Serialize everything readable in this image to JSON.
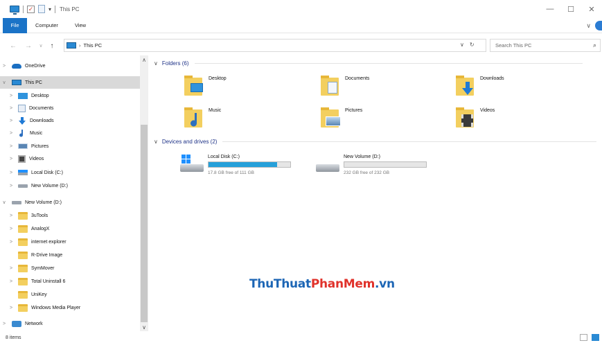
{
  "window": {
    "title": "This PC",
    "minimize": "—",
    "maximize": "☐",
    "close": "✕"
  },
  "ribbon": {
    "tabs": [
      "File",
      "Computer",
      "View"
    ],
    "collapse": "∨"
  },
  "address": {
    "back": "←",
    "forward": "→",
    "recent": "∨",
    "up": "↑",
    "path_sep": "›",
    "breadcrumb": "This PC",
    "dropdown": "∨",
    "refresh": "↻"
  },
  "search": {
    "placeholder": "Search This PC",
    "icon": "⌕"
  },
  "nav": {
    "items": [
      {
        "label": "OneDrive",
        "icon": "cloud-icon",
        "expand": ">"
      },
      {
        "label": "This PC",
        "icon": "computer-icon",
        "expand": "∨"
      },
      {
        "label": "Desktop",
        "icon": "desktop-icon",
        "expand": ">"
      },
      {
        "label": "Documents",
        "icon": "documents-icon",
        "expand": ">"
      },
      {
        "label": "Downloads",
        "icon": "downloads-icon",
        "expand": ">"
      },
      {
        "label": "Music",
        "icon": "music-icon",
        "expand": ">"
      },
      {
        "label": "Pictures",
        "icon": "pictures-icon",
        "expand": ">"
      },
      {
        "label": "Videos",
        "icon": "videos-icon",
        "expand": ">"
      },
      {
        "label": "Local Disk (C:)",
        "icon": "windows-drive-icon",
        "expand": ">"
      },
      {
        "label": "New Volume (D:)",
        "icon": "drive-icon",
        "expand": ">"
      },
      {
        "label": "New Volume (D:)",
        "icon": "drive-icon",
        "expand": "∨"
      },
      {
        "label": "3uTools",
        "icon": "folder-icon",
        "expand": ">"
      },
      {
        "label": "AnalogX",
        "icon": "folder-icon",
        "expand": ">"
      },
      {
        "label": "internet explorer",
        "icon": "folder-icon",
        "expand": ">"
      },
      {
        "label": "R-Drive Image",
        "icon": "folder-icon",
        "expand": ""
      },
      {
        "label": "SymMover",
        "icon": "folder-icon",
        "expand": ">"
      },
      {
        "label": "Total Uninstall 6",
        "icon": "folder-icon",
        "expand": ">"
      },
      {
        "label": "UniKey",
        "icon": "folder-icon",
        "expand": ""
      },
      {
        "label": "Windows Media Player",
        "icon": "folder-icon",
        "expand": ">"
      },
      {
        "label": "Network",
        "icon": "network-icon",
        "expand": ">"
      }
    ]
  },
  "scroll": {
    "up": "∧",
    "down": "∨"
  },
  "groups": {
    "folders": {
      "chevron": "∨",
      "title": "Folders (6)",
      "items": [
        "Desktop",
        "Documents",
        "Downloads",
        "Music",
        "Pictures",
        "Videos"
      ]
    },
    "drives": {
      "chevron": "∨",
      "title": "Devices and drives (2)",
      "items": [
        {
          "name": "Local Disk (C:)",
          "free": "17.8 GB free of 111 GB",
          "used_fraction": 0.84
        },
        {
          "name": "New Volume (D:)",
          "free": "232 GB free of 232 GB",
          "used_fraction": 0.0
        }
      ]
    }
  },
  "watermark": {
    "part1": "ThuThuat",
    "part2": "PhanMem",
    "part3": ".vn"
  },
  "status": {
    "count": "8 items"
  },
  "colors": {
    "accent": "#1a73c7",
    "progress": "#26a0da",
    "selected": "#d9d9d9"
  }
}
